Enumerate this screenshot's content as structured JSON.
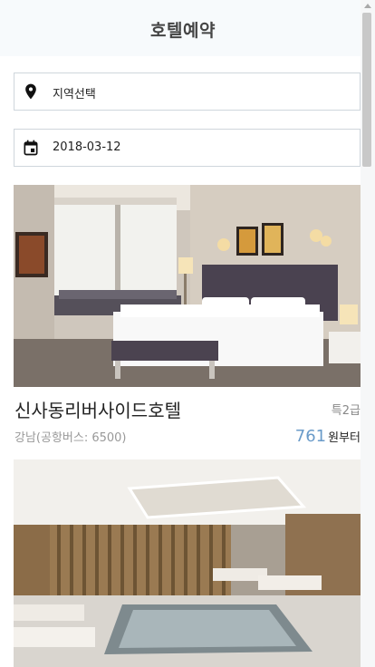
{
  "header": {
    "title": "호텔예약"
  },
  "search": {
    "location_label": "지역선택",
    "date_value": "2018-03-12"
  },
  "hotels": [
    {
      "name": "신사동리버사이드호텔",
      "grade": "특2급",
      "location": "강남(공항버스: 6500)",
      "price": "761",
      "price_suffix": "원부터"
    }
  ],
  "icons": {
    "location": "map-pin-icon",
    "date": "calendar-icon"
  },
  "colors": {
    "price": "#6a9bc9",
    "header_bg": "#f7fafc"
  }
}
